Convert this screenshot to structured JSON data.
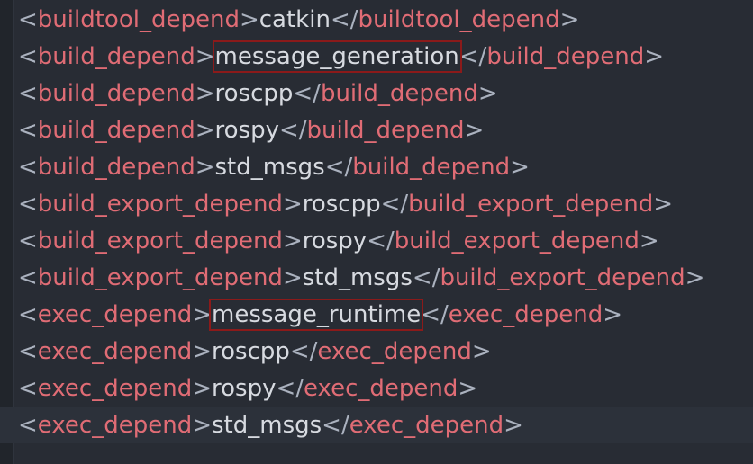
{
  "editor": {
    "colors": {
      "background": "#282c34",
      "tag": "#e06c75",
      "punctuation": "#abb2bf",
      "text": "#d7dae0",
      "highlight_box": "#8b1a1a"
    },
    "lines": [
      {
        "tag": "buildtool_depend",
        "value": "catkin"
      },
      {
        "tag": "build_depend",
        "value": "message_generation",
        "highlighted": true
      },
      {
        "tag": "build_depend",
        "value": "roscpp"
      },
      {
        "tag": "build_depend",
        "value": "rospy"
      },
      {
        "tag": "build_depend",
        "value": "std_msgs"
      },
      {
        "tag": "build_export_depend",
        "value": "roscpp"
      },
      {
        "tag": "build_export_depend",
        "value": "rospy"
      },
      {
        "tag": "build_export_depend",
        "value": "std_msgs"
      },
      {
        "tag": "exec_depend",
        "value": "message_runtime",
        "highlighted": true
      },
      {
        "tag": "exec_depend",
        "value": "roscpp"
      },
      {
        "tag": "exec_depend",
        "value": "rospy"
      },
      {
        "tag": "exec_depend",
        "value": "std_msgs",
        "current": true
      }
    ]
  }
}
